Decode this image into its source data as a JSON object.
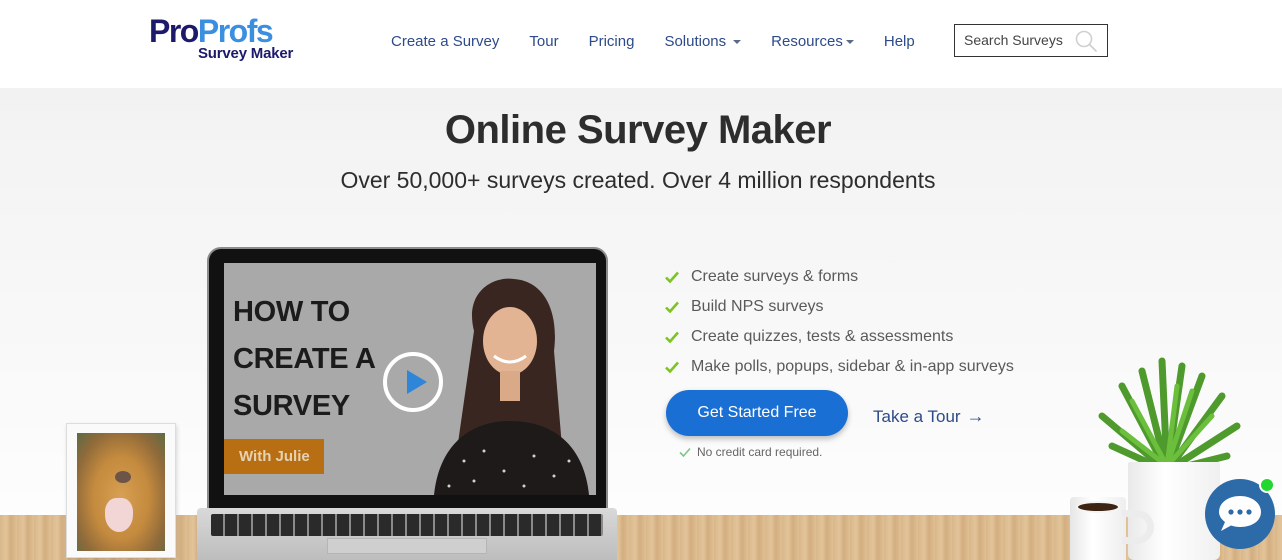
{
  "brand": {
    "logo_part1": "Pro",
    "logo_part2": "Profs",
    "logo_sub": "Survey Maker",
    "primary_color": "#1d1a6b",
    "accent_color": "#3a8fe0"
  },
  "nav": {
    "items": [
      {
        "label": "Create a Survey",
        "dropdown": false
      },
      {
        "label": "Tour",
        "dropdown": false
      },
      {
        "label": "Pricing",
        "dropdown": false
      },
      {
        "label": "Solutions",
        "dropdown": true
      },
      {
        "label": "Resources",
        "dropdown": true
      },
      {
        "label": "Help",
        "dropdown": false
      }
    ],
    "search": {
      "placeholder": "Search Surveys",
      "value": "",
      "icon": "search-icon"
    }
  },
  "hero": {
    "title": "Online Survey Maker",
    "subtitle": "Over 50,000+ surveys created. Over 4 million respondents"
  },
  "video": {
    "title_lines": [
      "HOW TO",
      "CREATE A",
      "SURVEY"
    ],
    "badge": "With Julie",
    "play_icon": "play-icon"
  },
  "features": {
    "items": [
      "Create surveys & forms",
      "Build NPS surveys",
      "Create quizzes, tests & assessments",
      "Make polls, popups, sidebar & in-app surveys"
    ],
    "check_color": "#7cc520"
  },
  "cta": {
    "primary_label": "Get Started Free",
    "primary_color": "#1a6fd4",
    "secondary_label": "Take a Tour",
    "secondary_arrow": "→",
    "note": "No credit card required."
  },
  "chat": {
    "icon": "chat-bubble-icon",
    "status": "online",
    "status_color": "#22d730"
  }
}
